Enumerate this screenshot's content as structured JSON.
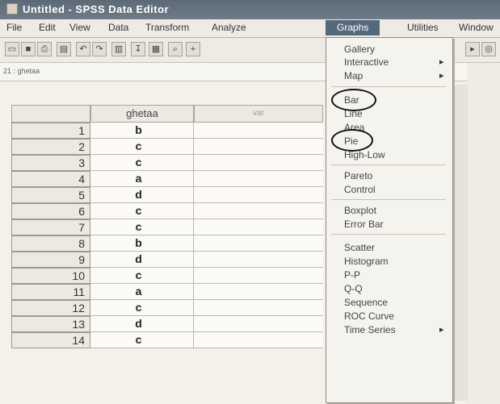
{
  "window": {
    "title": "Untitled - SPSS Data Editor"
  },
  "menubar": [
    "File",
    "Edit",
    "View",
    "Data",
    "Transform",
    "Analyze",
    "Graphs",
    "Utilities",
    "Window"
  ],
  "cell_reference": "21 : ghetaa",
  "grid": {
    "column_header": "ghetaa",
    "column2_header": "var",
    "rows": [
      {
        "n": "1",
        "v": "b"
      },
      {
        "n": "2",
        "v": "c"
      },
      {
        "n": "3",
        "v": "c"
      },
      {
        "n": "4",
        "v": "a"
      },
      {
        "n": "5",
        "v": "d"
      },
      {
        "n": "6",
        "v": "c"
      },
      {
        "n": "7",
        "v": "c"
      },
      {
        "n": "8",
        "v": "b"
      },
      {
        "n": "9",
        "v": "d"
      },
      {
        "n": "10",
        "v": "c"
      },
      {
        "n": "11",
        "v": "a"
      },
      {
        "n": "12",
        "v": "c"
      },
      {
        "n": "13",
        "v": "d"
      },
      {
        "n": "14",
        "v": "c"
      }
    ]
  },
  "graphs_menu": {
    "items": [
      "Gallery",
      "Interactive",
      "Map",
      "Bar",
      "Line",
      "Area",
      "Pie",
      "High-Low",
      "Pareto",
      "Control",
      "Boxplot",
      "Error Bar",
      "Scatter",
      "Histogram",
      "P-P",
      "Q-Q",
      "Sequence",
      "ROC Curve",
      "Time Series"
    ]
  }
}
